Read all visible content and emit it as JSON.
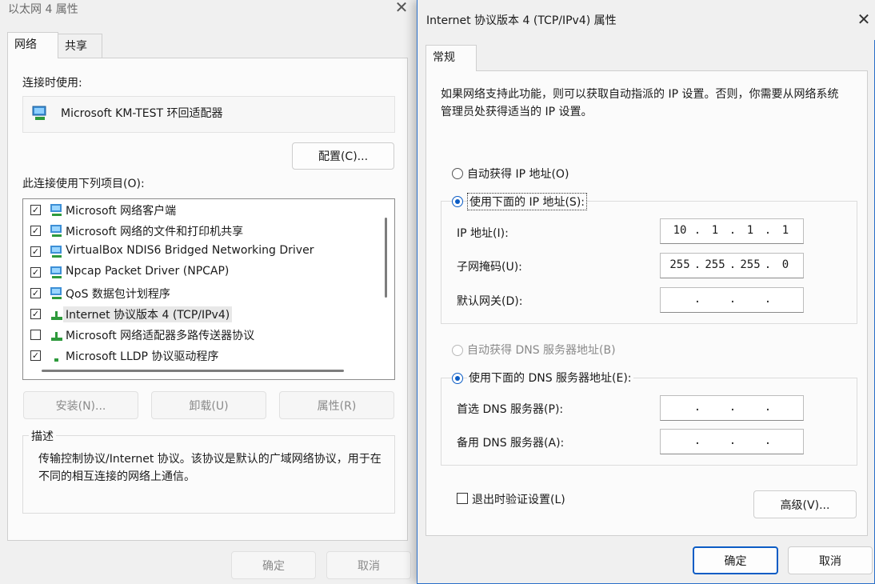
{
  "background_dialog": {
    "title": "以太网 4 属性",
    "tabs": [
      {
        "label": "网络"
      },
      {
        "label": "共享"
      }
    ],
    "connect_using_label": "连接时使用:",
    "adapter_name": "Microsoft KM-TEST 环回适配器",
    "configure_button": "配置(C)...",
    "items_label": "此连接使用下列项目(O):",
    "items": [
      {
        "label": "Microsoft 网络客户端",
        "checked": true,
        "icon": "network-client-icon"
      },
      {
        "label": "Microsoft 网络的文件和打印机共享",
        "checked": true,
        "icon": "file-share-icon"
      },
      {
        "label": "VirtualBox NDIS6 Bridged Networking Driver",
        "checked": true,
        "icon": "driver-icon"
      },
      {
        "label": "Npcap Packet Driver (NPCAP)",
        "checked": true,
        "icon": "driver-icon"
      },
      {
        "label": "QoS 数据包计划程序",
        "checked": true,
        "icon": "qos-icon"
      },
      {
        "label": "Internet 协议版本 4 (TCP/IPv4)",
        "checked": true,
        "icon": "protocol-icon",
        "selected": true
      },
      {
        "label": "Microsoft 网络适配器多路传送器协议",
        "checked": false,
        "icon": "protocol-icon"
      },
      {
        "label": "Microsoft LLDP 协议驱动程序",
        "checked": true,
        "icon": "protocol-icon"
      }
    ],
    "install_button": "安装(N)...",
    "uninstall_button": "卸载(U)",
    "properties_button": "属性(R)",
    "description_title": "描述",
    "description_text": "传输控制协议/Internet 协议。该协议是默认的广域网络协议，用于在不同的相互连接的网络上通信。",
    "ok_button": "确定",
    "cancel_button": "取消"
  },
  "ipv4_dialog": {
    "title": "Internet 协议版本 4 (TCP/IPv4) 属性",
    "tab_general": "常规",
    "intro_text": "如果网络支持此功能，则可以获取自动指派的 IP 设置。否则，你需要从网络系统管理员处获得适当的 IP 设置。",
    "auto_ip_radio": "自动获得 IP 地址(O)",
    "manual_ip_radio": "使用下面的 IP 地址(S):",
    "ip_address_label": "IP 地址(I):",
    "ip_address": [
      "10",
      "1",
      "1",
      "1"
    ],
    "subnet_mask_label": "子网掩码(U):",
    "subnet_mask": [
      "255",
      "255",
      "255",
      "0"
    ],
    "gateway_label": "默认网关(D):",
    "gateway": [
      "",
      "",
      "",
      ""
    ],
    "auto_dns_radio": "自动获得 DNS 服务器地址(B)",
    "manual_dns_radio": "使用下面的 DNS 服务器地址(E):",
    "preferred_dns_label": "首选 DNS 服务器(P):",
    "preferred_dns": [
      "",
      "",
      "",
      ""
    ],
    "alternate_dns_label": "备用 DNS 服务器(A):",
    "alternate_dns": [
      "",
      "",
      "",
      ""
    ],
    "validate_on_exit_label": "退出时验证设置(L)",
    "advanced_button": "高级(V)...",
    "ok_button": "确定",
    "cancel_button": "取消",
    "accent_color": "#0b5cc5"
  }
}
